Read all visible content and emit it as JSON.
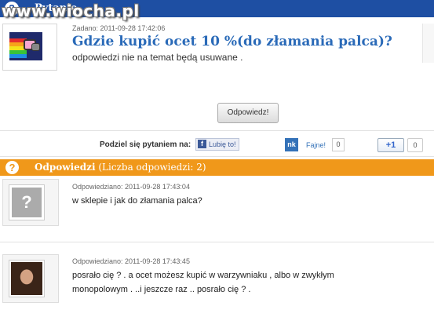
{
  "watermark": "www.wiocha.pl",
  "question_header": {
    "badge": "?",
    "title": "Pytanie"
  },
  "question": {
    "meta": "Zadano: 2011-09-28 17:42:06",
    "title": "Gdzie kupić ocet 10 %(do złamania palca)?",
    "description": "odpowiedzi nie na temat będą usuwane ."
  },
  "answer_button": "Odpowiedz!",
  "share": {
    "label": "Podziel się pytaniem na:",
    "facebook_like": "Lubię to!",
    "nk_logo": "nk",
    "nk_label": "Fajne!",
    "nk_count": "0",
    "gplus_label": "+1",
    "gplus_count": "0"
  },
  "answers_header": {
    "badge": "?",
    "title": "Odpowiedzi",
    "count_text": "(Liczba odpowiedzi: 2)"
  },
  "answers": [
    {
      "meta": "Odpowiedziano: 2011-09-28 17:43:04",
      "text": "w sklepie i jak do złamania palca?"
    },
    {
      "meta": "Odpowiedziano: 2011-09-28 17:43:45",
      "text_line1": "posrało cię ? . a ocet możesz kupić w warzywniaku , albo w zwykłym",
      "text_line2": "monopolowym . ..i jeszcze raz .. posrało cię ? ."
    }
  ],
  "colors": {
    "question_bar": "#1e4fa3",
    "answer_bar": "#f0981a",
    "title_link": "#2a6ab8"
  }
}
